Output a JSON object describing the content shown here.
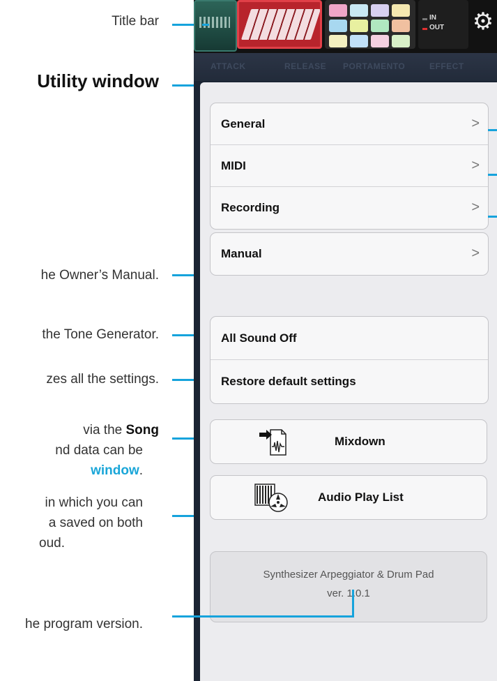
{
  "annotations": {
    "title_bar": "Title bar",
    "utility_window": "Utility window",
    "manual": "he Owner’s Manual.",
    "all_sound_off": "the Tone Generator.",
    "restore": "zes all the settings.",
    "mixdown_l1_pre": "via the ",
    "mixdown_l1_bold": "Song",
    "mixdown_l2": "nd data can be",
    "mixdown_l3_link": "window",
    "mixdown_l3_end": ".",
    "playlist_l1": "in which you can",
    "playlist_l2": "a saved on both",
    "playlist_l3": "oud.",
    "version": "he program version."
  },
  "title_bar": {
    "io_in": "IN",
    "io_out": "OUT",
    "tabs": [
      "ATTACK",
      "RELEASE",
      "PORTAMENTO",
      "EFFECT"
    ]
  },
  "menu": {
    "general": "General",
    "midi": "MIDI",
    "recording": "Recording",
    "manual": "Manual",
    "all_sound_off": "All Sound Off",
    "restore": "Restore default settings",
    "mixdown": "Mixdown",
    "audio_play_list": "Audio Play List",
    "chevron": ">"
  },
  "version_box": {
    "app_name": "Synthesizer Arpeggiator & Drum Pad",
    "version": "ver. 1.0.1"
  },
  "colors": {
    "callout": "#16a3dc",
    "panel": "#ececef",
    "screen_bg": "#1b2433"
  }
}
